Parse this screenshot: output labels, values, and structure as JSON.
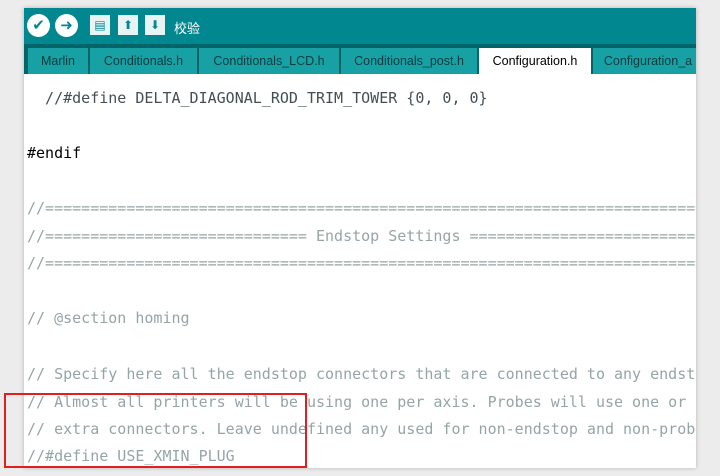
{
  "toolbar": {
    "verify_icon": "check-icon",
    "upload_icon": "arrow-right-icon",
    "new_icon": "new-file-icon",
    "open_icon": "upload-arrow-icon",
    "save_icon": "download-arrow-icon",
    "status_label": "校验"
  },
  "tabs": [
    {
      "label": "Marlin"
    },
    {
      "label": "Conditionals.h"
    },
    {
      "label": "Conditionals_LCD.h"
    },
    {
      "label": "Conditionals_post.h"
    },
    {
      "label": "Configuration.h",
      "active": true
    },
    {
      "label": "Configuration_a"
    }
  ],
  "code": [
    "  //#define DELTA_DIAGONAL_ROD_TRIM_TOWER {0, 0, 0}",
    "",
    "#endif",
    "",
    "//===========================================================================",
    "//============================= Endstop Settings ============================",
    "//===========================================================================",
    "",
    "// @section homing",
    "",
    "// Specify here all the endstop connectors that are connected to any endstop",
    "// Almost all printers will be using one per axis. Probes will use one or",
    "// extra connectors. Leave undefined any used for non-endstop and non-probe",
    "//#define USE_XMIN_PLUG"
  ],
  "colors": {
    "toolbar": "#00878f",
    "tabbar": "#006468",
    "tab": "#17a1a5",
    "highlight": "#e02020"
  }
}
